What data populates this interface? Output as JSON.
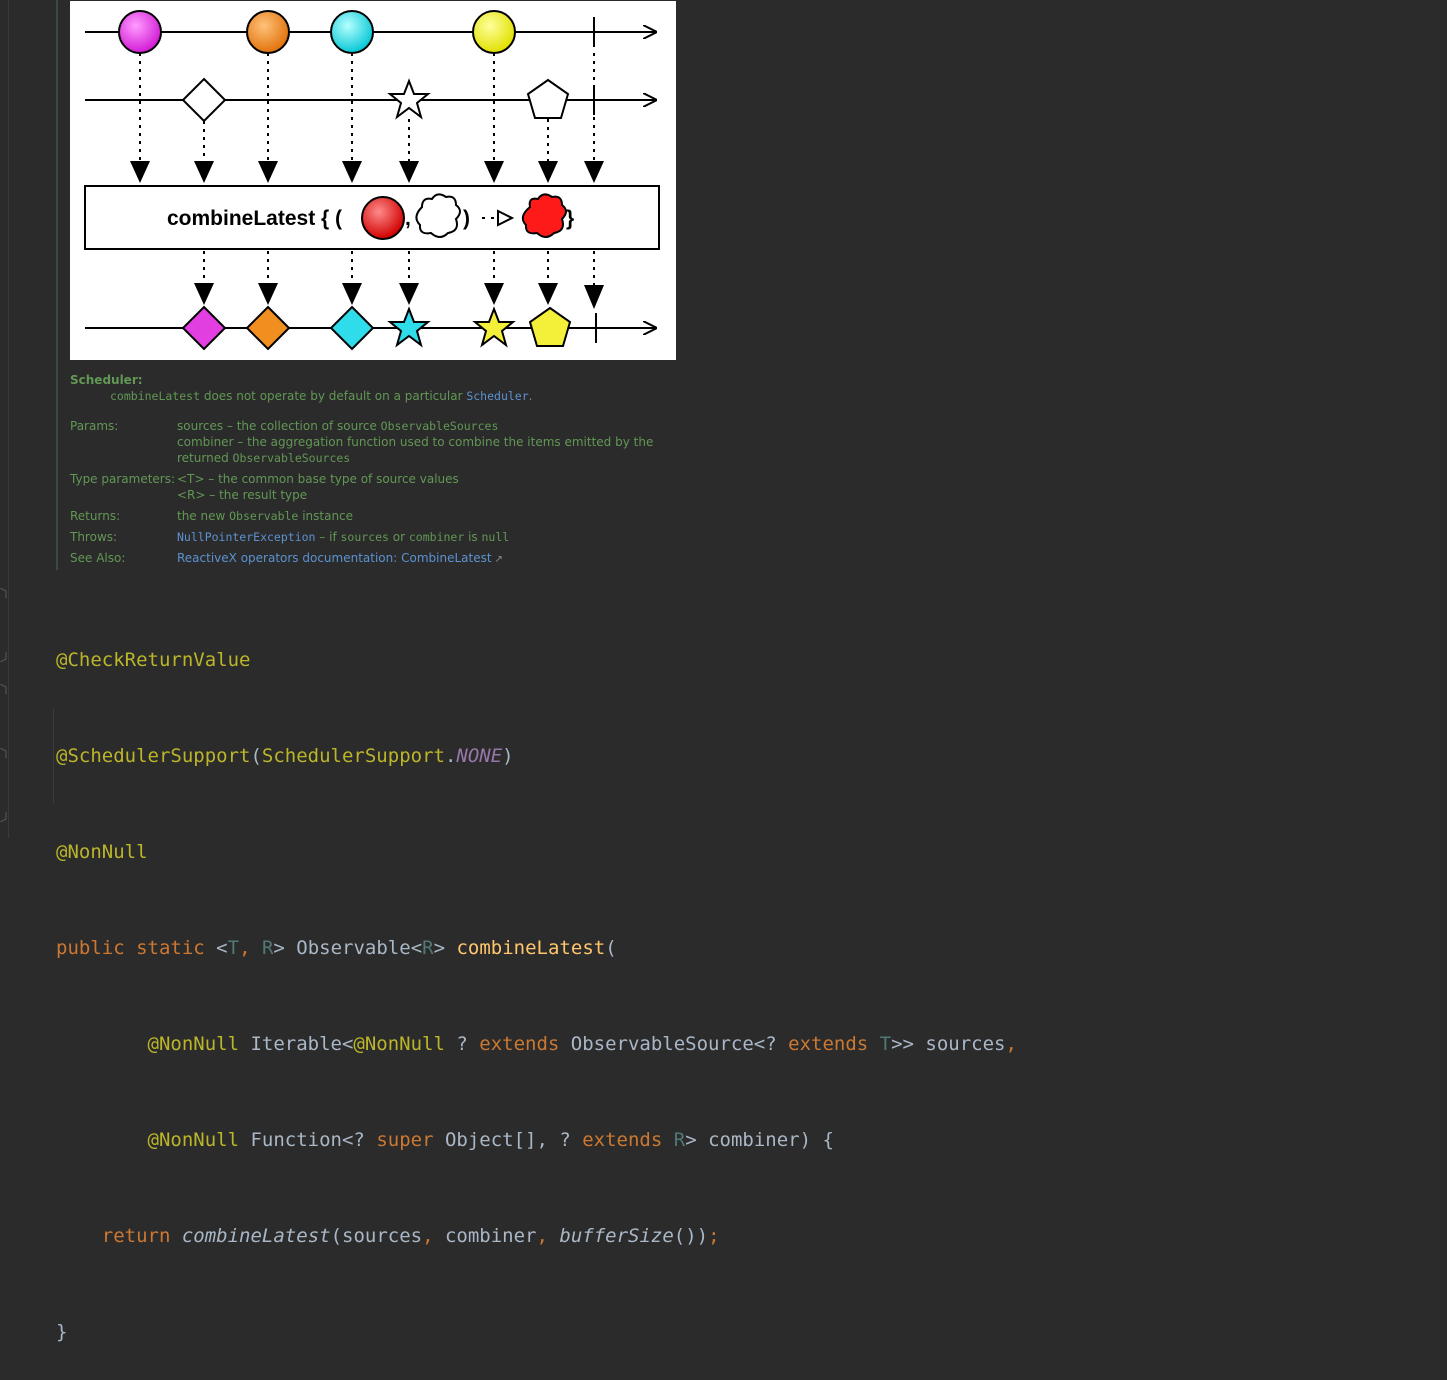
{
  "diagram": {
    "operator_label": "combineLatest { (",
    "comma": ",",
    "paren_close": ")",
    "brace_close": "}"
  },
  "doc": {
    "scheduler": {
      "heading": "Scheduler:",
      "code_name": "combineLatest",
      "text": " does not operate by default on a particular ",
      "link": "Scheduler",
      "end": "."
    },
    "params": {
      "term": "Params:",
      "line1_text": "sources – the collection of source ",
      "line1_code": "ObservableSources",
      "line2_text": "combiner – the aggregation function used to combine the items emitted by the",
      "line3_text": "returned ",
      "line3_code": "ObservableSources"
    },
    "type_params": {
      "term": "Type parameters:",
      "line1": "<T> – the common base type of source values",
      "line2": "<R> – the result type"
    },
    "returns": {
      "term": "Returns:",
      "text1": "the new ",
      "code": "Observable",
      "text2": " instance"
    },
    "throws": {
      "term": "Throws:",
      "link": "NullPointerException",
      "text1": " – if ",
      "code1": "sources",
      "text2": " or ",
      "code2": "combiner",
      "text3": " is ",
      "code3": "null"
    },
    "see_also": {
      "term": "See Also:",
      "link": "ReactiveX operators documentation: CombineLatest",
      "arrow": "↗"
    }
  },
  "code": {
    "l1": {
      "ann": "@CheckReturnValue"
    },
    "l2": {
      "ann": "@SchedulerSupport",
      "p1": "(",
      "cls": "SchedulerSupport",
      "dot": ".",
      "cst": "NONE",
      "p2": ")"
    },
    "l3": {
      "ann": "@NonNull"
    },
    "l4": {
      "kw1": "public",
      "sp1": " ",
      "kw2": "static",
      "lt": " <",
      "t": "T",
      "c": ", ",
      "r": "R",
      "gt": "> Observable<",
      "r2": "R",
      "gt2": "> ",
      "fn": "combineLatest",
      "p": "("
    },
    "l5": {
      "ind": "        ",
      "ann1": "@NonNull",
      "a": " Iterable<",
      "ann2": "@NonNull",
      "b": " ? ",
      "kw1": "extends",
      "c": " ObservableSource<? ",
      "kw2": "extends",
      "d": " ",
      "t": "T",
      "e": ">> sources",
      "comma": ","
    },
    "l6": {
      "ind": "        ",
      "ann": "@NonNull",
      "a": " Function<? ",
      "kw1": "super",
      "b": " Object[], ? ",
      "kw2": "extends",
      "c": " ",
      "r": "R",
      "d": "> combiner) {"
    },
    "l7": {
      "ind": "    ",
      "kw": "return",
      "sp": " ",
      "fn": "combineLatest",
      "a": "(sources",
      "c1": ",",
      "b": " combiner",
      "c2": ",",
      "sp2": " ",
      "fn2": "bufferSize",
      "d": "())",
      "semi": ";"
    },
    "l8": {
      "brace": "}"
    }
  }
}
